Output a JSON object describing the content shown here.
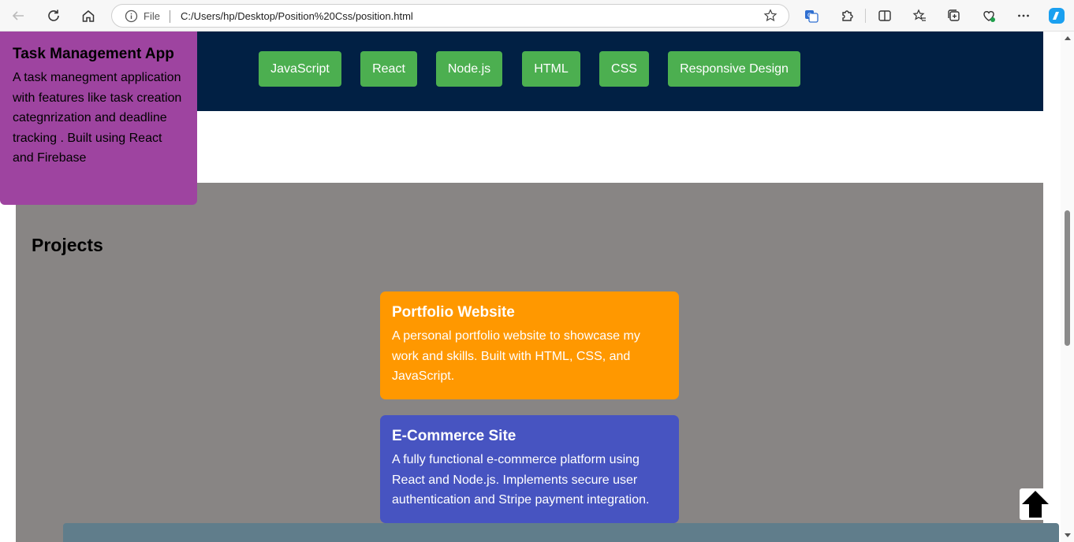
{
  "browser": {
    "omnibox_scheme": "File",
    "url": "C:/Users/hp/Desktop/Position%20Css/position.html"
  },
  "skills": [
    "JavaScript",
    "React",
    "Node.js",
    "HTML",
    "CSS",
    "Responsive Design"
  ],
  "task_card": {
    "title": "Task Management App",
    "description": "A task manegment application with features like task creation categnrization and deadline tracking . Built using React and Firebase"
  },
  "projects": {
    "heading": "Projects",
    "items": [
      {
        "title": "Portfolio Website",
        "description": "A personal portfolio website to showcase my work and skills. Built with HTML, CSS, and JavaScript."
      },
      {
        "title": "E-Commerce Site",
        "description": "A fully functional e-commerce platform using React and Node.js. Implements secure user authentication and Stripe payment integration."
      }
    ]
  },
  "colors": {
    "header_band": "#012044",
    "skill_button": "#4caf50",
    "projects_bg": "#888584",
    "portfolio_card": "#ff9800",
    "ecommerce_card": "#4754c1",
    "task_card": "#9e44a0",
    "footer_bar": "#607d8b"
  },
  "icons": {
    "back": "back-arrow-icon",
    "reload": "reload-icon",
    "home": "home-icon",
    "info": "info-icon",
    "favorite": "star-icon",
    "to_top": "arrow-up-icon"
  }
}
